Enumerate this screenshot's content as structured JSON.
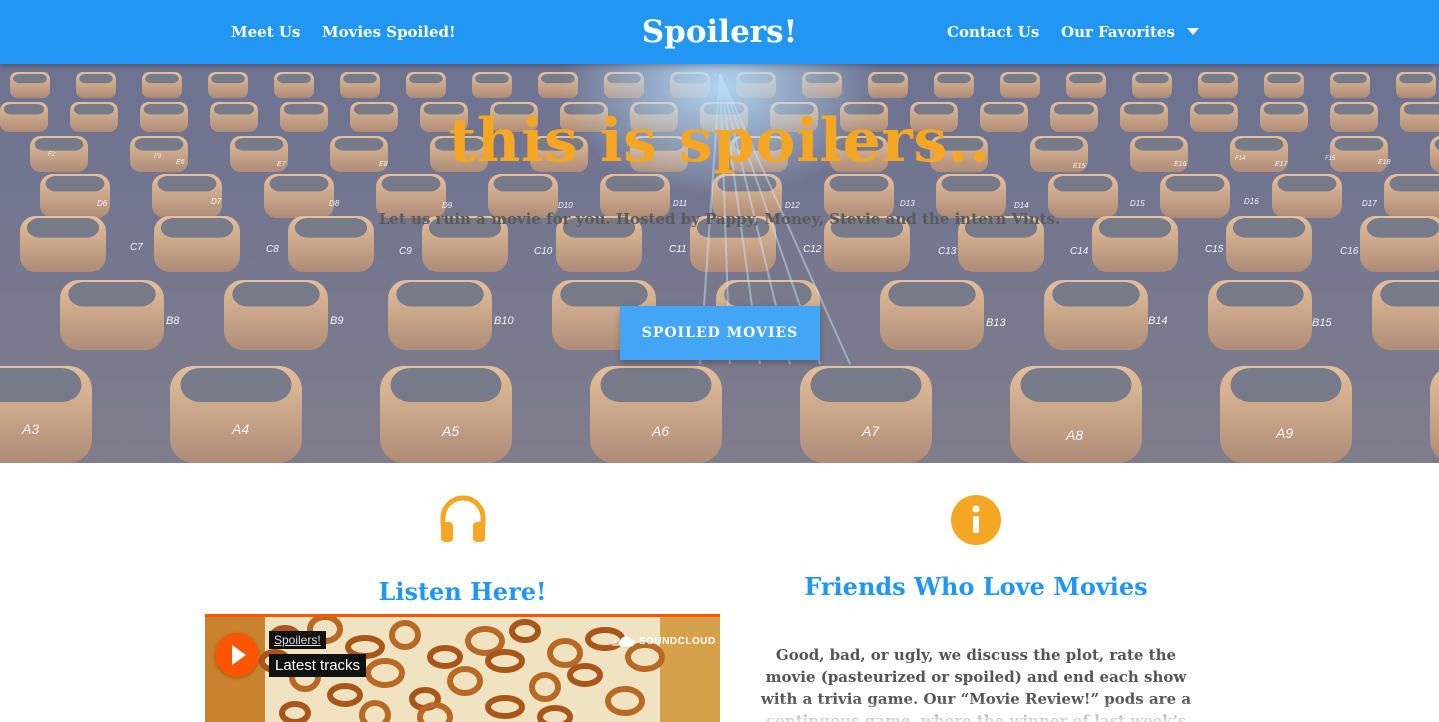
{
  "nav": {
    "brand": "Spoilers!",
    "left_links": [
      "Meet Us",
      "Movies Spoiled!"
    ],
    "right_links": [
      "Contact Us",
      "Our Favorites"
    ],
    "dropdown_icon": "caret-down-icon",
    "color": "#2196f3"
  },
  "hero": {
    "title": "this is spoilers..",
    "subtitle": "Let us ruin a movie for you. Hosted by Pappy, Money, Stevie and the intern Vints.",
    "button_label": "SPOILED MOVIES",
    "title_color": "#f5a623",
    "seat_labels": [
      "A3",
      "A4",
      "A5",
      "A6",
      "A7",
      "A8",
      "A9",
      "B8",
      "B9",
      "B10",
      "B13",
      "B14",
      "B15",
      "C7",
      "C8",
      "C9",
      "C10",
      "C11",
      "C12",
      "C13",
      "C14",
      "C15",
      "C16",
      "D6",
      "D7",
      "D8",
      "D9",
      "D10",
      "D11",
      "D12",
      "D13",
      "D14",
      "D15",
      "D16",
      "D17",
      "E6",
      "E7",
      "E8",
      "E15",
      "E16",
      "E17",
      "E18",
      "F2",
      "F3",
      "F14",
      "F15"
    ]
  },
  "listen": {
    "icon": "headphones-icon",
    "title": "Listen Here!",
    "player": {
      "user": "Spoilers!",
      "track": "Latest tracks",
      "brand": "SOUNDCLOUD",
      "play_icon": "play-icon",
      "accent": "#ff5500"
    }
  },
  "friends": {
    "icon": "info-icon",
    "title": "Friends Who Love Movies",
    "description": "Good, bad, or ugly, we discuss the plot, rate the movie (pasteurized or spoiled) and end each show with a trivia game. Our “Movie Review!” pods are a continuous game, where the winner of last week’s"
  }
}
